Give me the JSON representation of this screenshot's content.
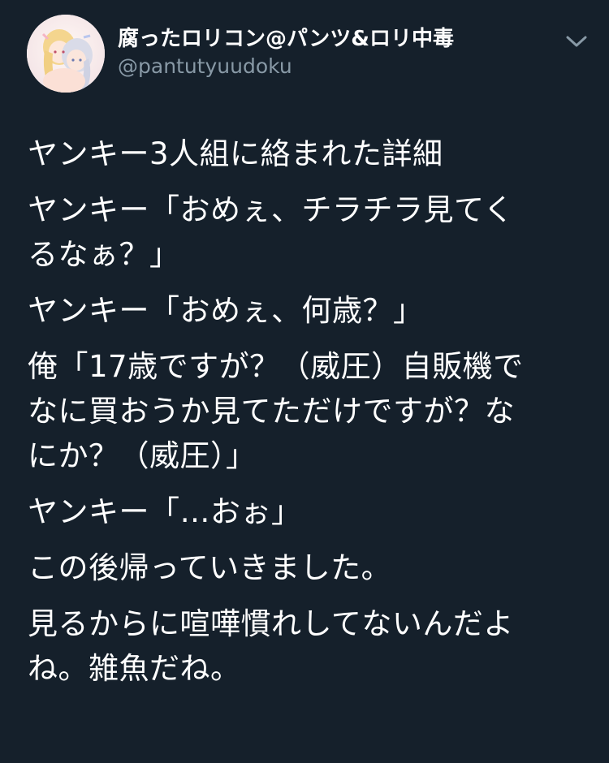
{
  "account": {
    "display_name": "腐ったロリコン@パンツ&ロリ中毒",
    "handle": "@pantutyuudoku",
    "avatar_icon": "avatar-illustration"
  },
  "menu": {
    "icon": "chevron-down-icon"
  },
  "tweet": {
    "paragraphs": [
      "ヤンキー3人組に絡まれた詳細",
      "ヤンキー「おめぇ、チラチラ見てく\nるなぁ？」",
      "ヤンキー「おめぇ、何歳？」",
      "俺「17歳ですが？（威圧）自販機で\nなに買おうか見てただけですが？な\nにか？（威圧）」",
      "ヤンキー「…おぉ」",
      "この後帰っていきました。",
      "見るからに喧嘩慣れしてないんだよ\nね。雑魚だね。"
    ]
  },
  "colors": {
    "background": "#15202b",
    "text": "#ffffff",
    "secondary_text": "#8899a6"
  }
}
